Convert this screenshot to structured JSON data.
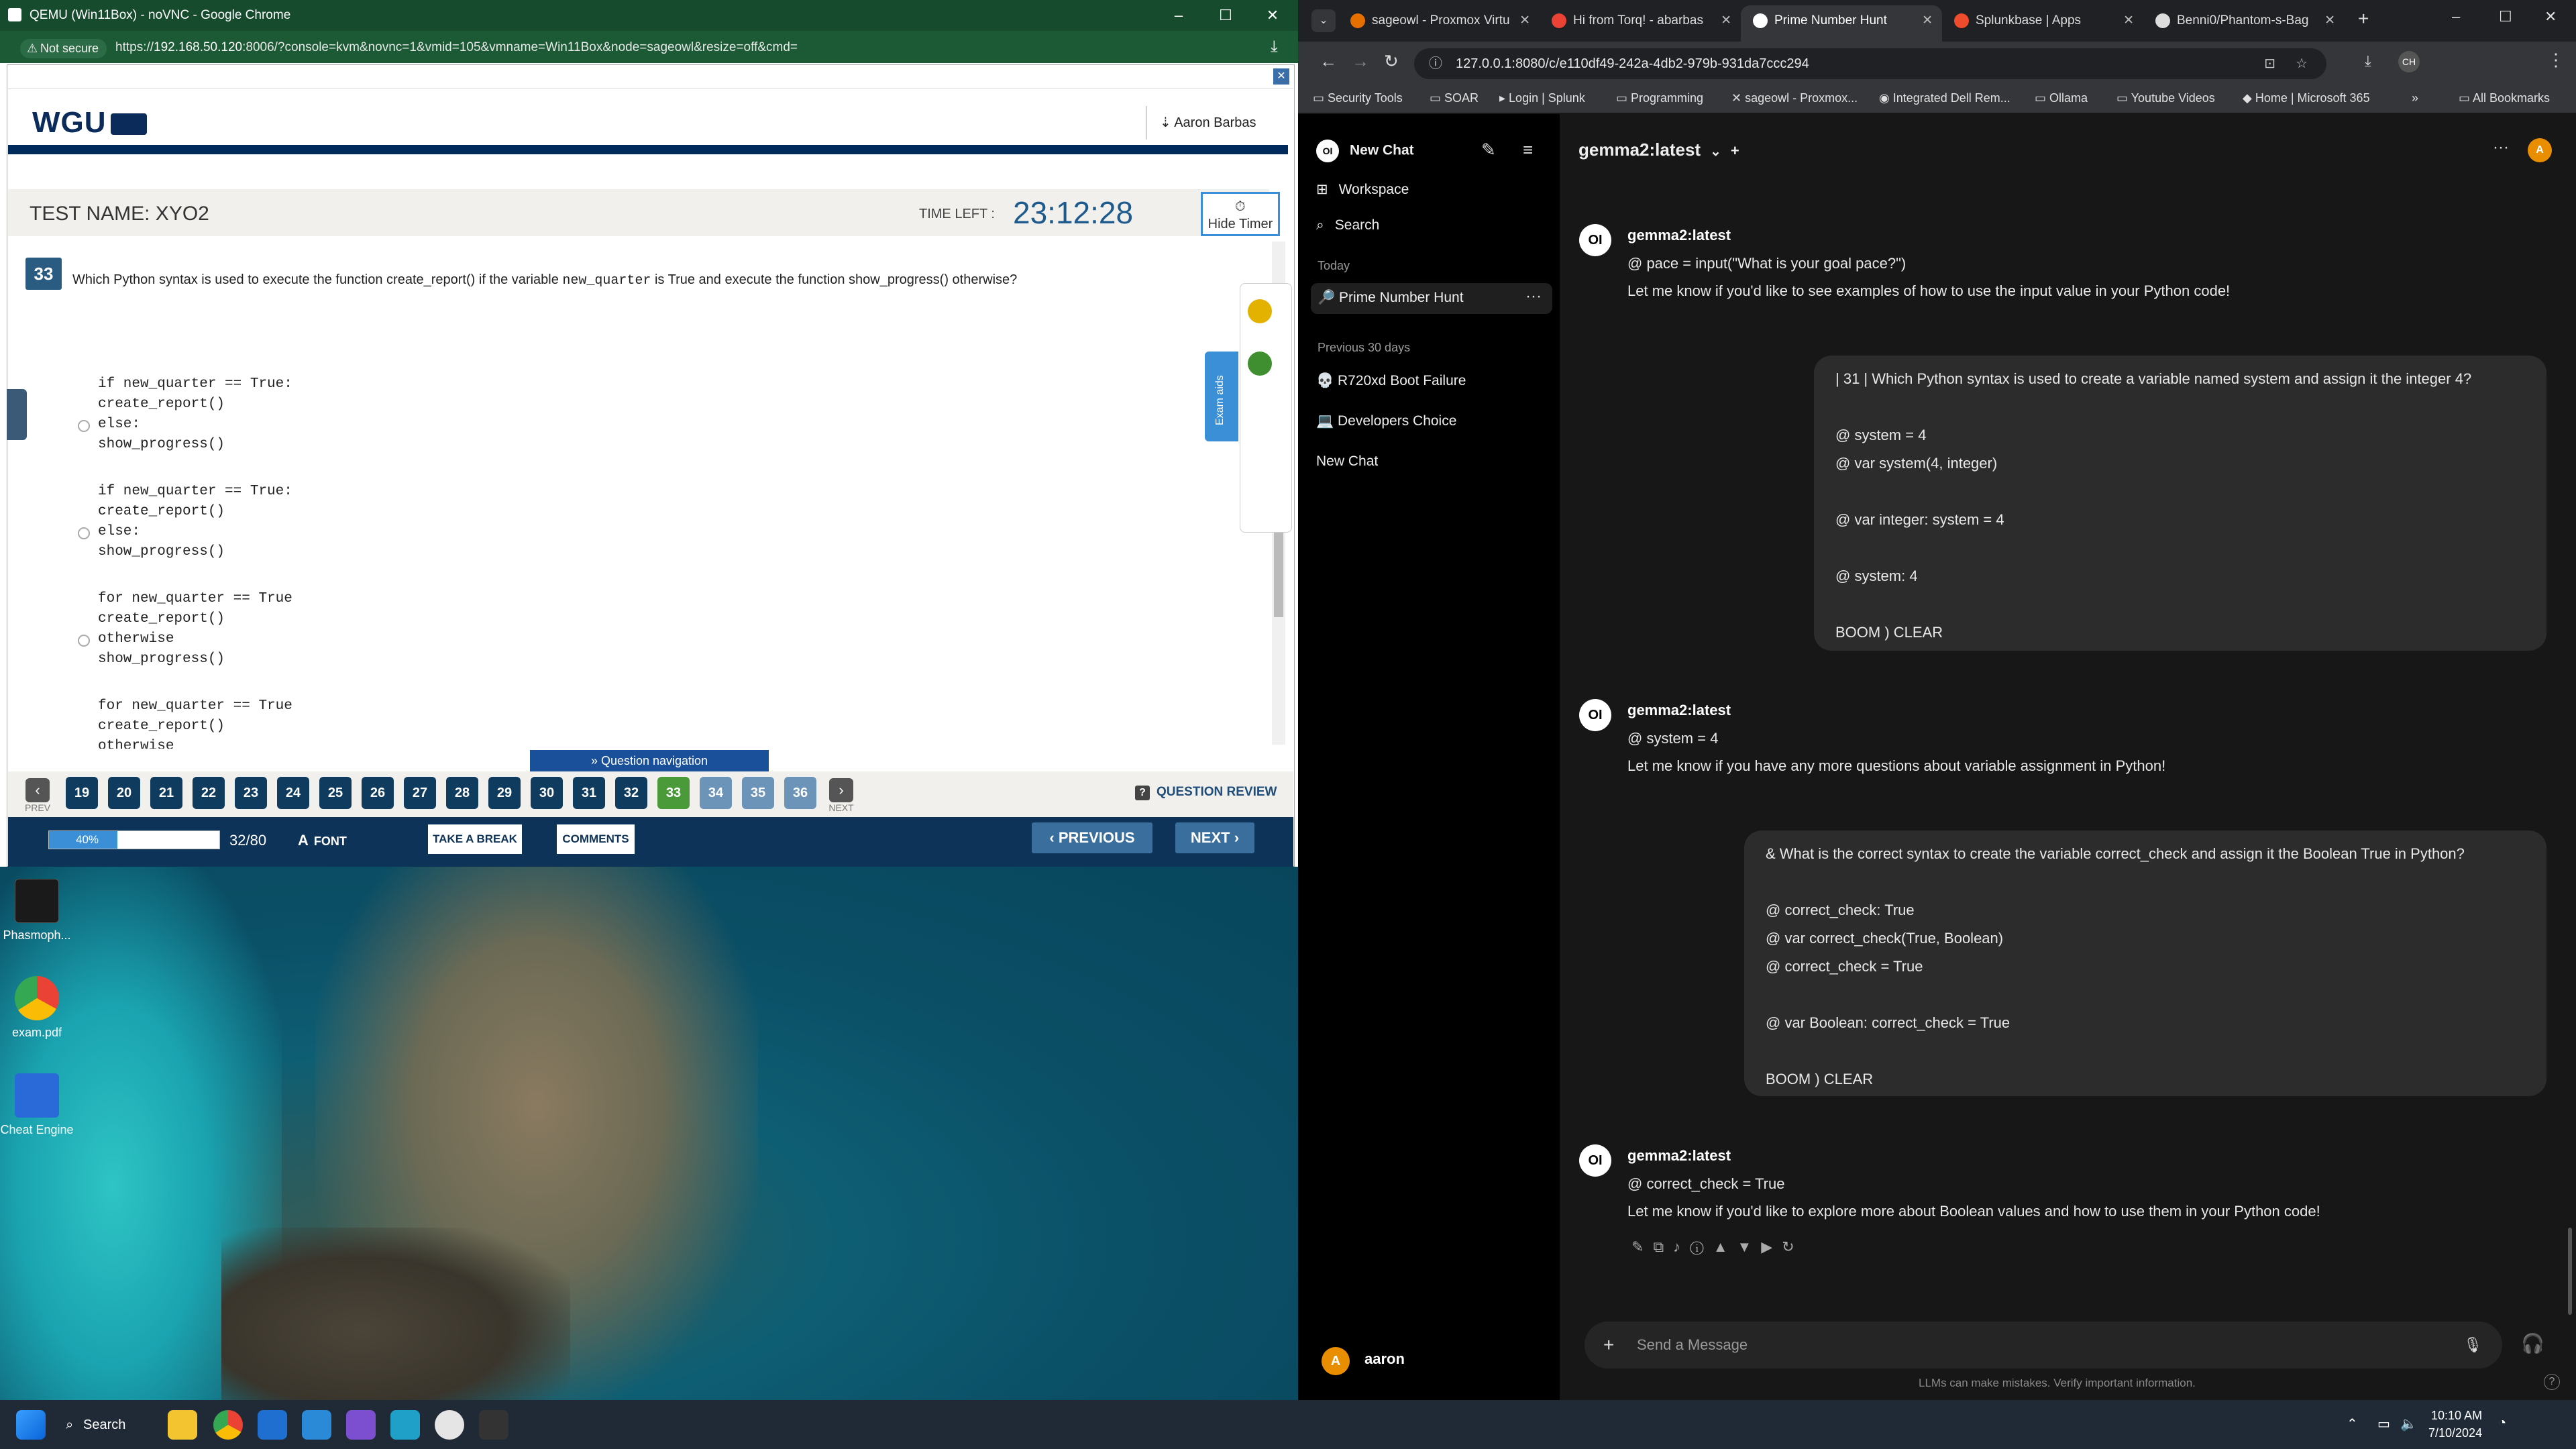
{
  "left_window": {
    "title": "QEMU (Win11Box) - noVNC - Google Chrome",
    "security": "Not secure",
    "url_scheme": "https://",
    "url_host": "192.168.50.120",
    "url_rest": ":8006/?console=kvm&novnc=1&vmid=105&vmname=Win11Box&node=sageowl&resize=off&cmd="
  },
  "exam": {
    "logo": "WGU",
    "user": "⇣ Aaron Barbas",
    "test_name": "TEST NAME:  XYO2",
    "time_left_label": "TIME LEFT :",
    "time_left": "23:12:28",
    "hide_timer": "Hide Timer",
    "exam_aids": "Exam aids",
    "question_number": "33",
    "question_pre": "Which Python syntax is used to execute the function create_report() if the variable ",
    "question_var": "new_quarter",
    "question_post": " is True and execute the function show_progress() otherwise?",
    "options": [
      "if new_quarter == True:\ncreate_report()\nelse:\nshow_progress()",
      "if new_quarter == True:\ncreate_report()\nelse:\nshow_progress()",
      "for new_quarter == True\ncreate_report()\notherwise\nshow_progress()",
      "for new_quarter == True\ncreate_report()\notherwise"
    ],
    "question_navigation": "» Question navigation",
    "prev": "PREV",
    "next_small": "NEXT",
    "nav_numbers": [
      "19",
      "20",
      "21",
      "22",
      "23",
      "24",
      "25",
      "26",
      "27",
      "28",
      "29",
      "30",
      "31",
      "32",
      "33",
      "34",
      "35",
      "36"
    ],
    "current": "33",
    "question_review": "QUESTION REVIEW",
    "progress_percent": 40,
    "progress_label": "40%",
    "answered": "32/80",
    "font": "FONT",
    "take_break": "TAKE A BREAK",
    "comments": "COMMENTS",
    "previous": "PREVIOUS",
    "next": "NEXT"
  },
  "desktop_icons": [
    "Phasmoph...",
    "exam.pdf",
    "Cheat Engine"
  ],
  "right_window": {
    "tabs": [
      "sageowl - Proxmox Virtu",
      "Hi from Torq! - abarbas",
      "Prime Number Hunt",
      "Splunkbase | Apps",
      "Benni0/Phantom-s-Bag"
    ],
    "active_tab": "Prime Number Hunt",
    "url": "127.0.0.1:8080/c/e110df49-242a-4db2-979b-931da7ccc294",
    "bookmarks": [
      "Security Tools",
      "SOAR",
      "Login | Splunk",
      "Programming",
      "sageowl - Proxmox...",
      "Integrated Dell Rem...",
      "Ollama",
      "Youtube Videos",
      "Home | Microsoft 365"
    ],
    "all_bookmarks": "All Bookmarks"
  },
  "sidebar": {
    "new_chat": "New Chat",
    "workspace": "Workspace",
    "search": "Search",
    "today": "Today",
    "today_items": [
      "🔎 Prime Number Hunt"
    ],
    "previous_label": "Previous 30 days",
    "previous_items": [
      "💀 R720xd Boot Failure",
      "💻 Developers Choice",
      "New Chat"
    ],
    "user": "aaron",
    "user_initial": "A"
  },
  "chat": {
    "model": "gemma2:latest",
    "messages": [
      {
        "role": "assistant",
        "name": "gemma2:latest",
        "lines": [
          "@ pace = input(\"What is your goal pace?\")",
          "Let me know if you'd like to see examples of how to use the input value in your Python code!"
        ]
      },
      {
        "role": "user",
        "lines": [
          "| 31 | Which Python syntax is used to create a variable named system and assign it the integer 4?",
          "",
          "@ system = 4",
          "@ var system(4, integer)",
          "",
          "@ var integer: system = 4",
          "",
          "@ system: 4",
          "",
          "BOOM ) CLEAR"
        ]
      },
      {
        "role": "assistant",
        "name": "gemma2:latest",
        "lines": [
          "@ system = 4",
          "Let me know if you have any more questions about variable assignment in Python!"
        ]
      },
      {
        "role": "user",
        "lines": [
          "& What is the correct syntax to create the variable correct_check and assign it the Boolean True in Python?",
          "",
          "@ correct_check: True",
          "@ var correct_check(True, Boolean)",
          "@ correct_check = True",
          "",
          "@ var Boolean: correct_check = True",
          "",
          "BOOM ) CLEAR"
        ]
      },
      {
        "role": "assistant",
        "name": "gemma2:latest",
        "lines": [
          "@ correct_check = True",
          "Let me know if you'd like to explore more about Boolean values and how to use them in your Python code!"
        ]
      }
    ],
    "composer_placeholder": "Send a Message",
    "disclaimer": "LLMs can make mistakes. Verify important information."
  },
  "taskbar": {
    "search": "Search",
    "time": "10:10 AM",
    "date": "7/10/2024"
  }
}
